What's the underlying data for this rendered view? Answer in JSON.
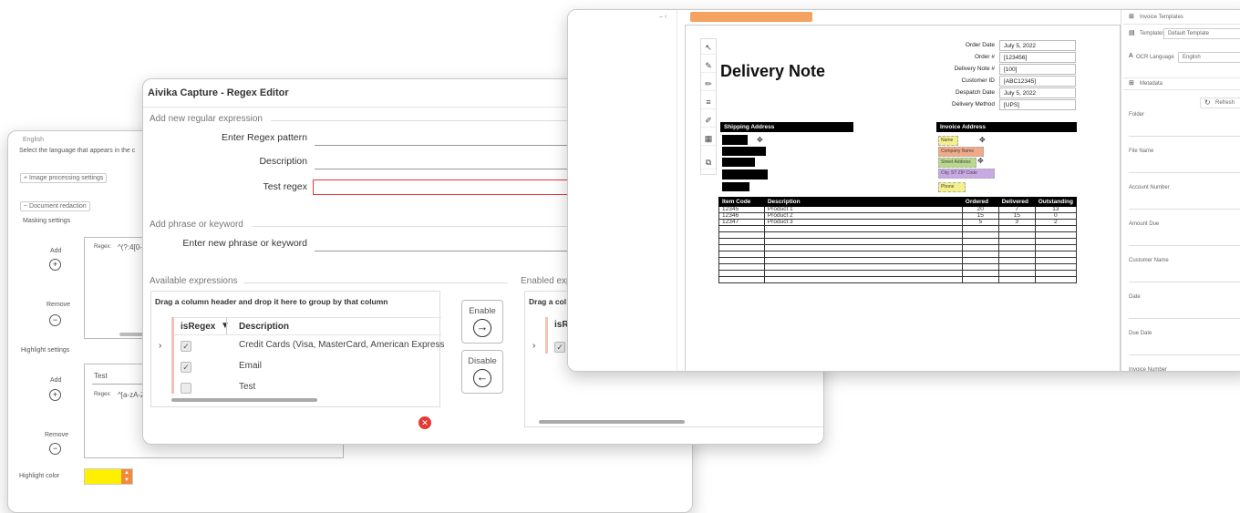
{
  "back": {
    "language_label": "English",
    "language_hint": "Select the language that appears in the c",
    "image_processing": "Image processing settings",
    "doc_redaction": "Document redaction",
    "masking_settings": "Masking settings",
    "add": "Add",
    "remove": "Remove",
    "regex_prefix": "Regex:",
    "mask_regex": "^(?:4[0-",
    "highlight_settings": "Highlight settings",
    "test_name": "Test",
    "hl_regex": "^[a-zA-Z",
    "highlight_color": "Highlight color",
    "highlight_color_hex": "#ffef00"
  },
  "regex_editor": {
    "title": "Aivika Capture - Regex Editor",
    "add_new_regex": "Add new regular expression",
    "pattern_label": "Enter Regex pattern",
    "description_label": "Description",
    "test_label": "Test regex",
    "add_phrase": "Add phrase or keyword",
    "phrase_label": "Enter new phrase or keyword",
    "available": "Available expressions",
    "enabled": "Enabled exp",
    "group_hint": "Drag a column header and drop it here to group by that column",
    "group_hint_short": "Drag a col",
    "col_isregex": "isRegex",
    "col_isregex_short": "isRe",
    "col_description": "Description",
    "rows": [
      {
        "checked": true,
        "description": "Credit Cards (Visa, MasterCard, American Express"
      },
      {
        "checked": true,
        "description": "Email"
      },
      {
        "checked": false,
        "description": "Test"
      }
    ],
    "enable_btn": "Enable",
    "disable_btn": "Disable"
  },
  "capture": {
    "doc_title": "Delivery Note",
    "meta": [
      {
        "label": "Order Date",
        "value": "July 5, 2022"
      },
      {
        "label": "Order #",
        "value": "[123456]"
      },
      {
        "label": "Delivery Note #",
        "value": "[100]"
      },
      {
        "label": "Customer ID",
        "value": "[ABC12345]"
      },
      {
        "label": "Despatch Date",
        "value": "July 5, 2022"
      },
      {
        "label": "Delivery Method",
        "value": "[UPS]"
      }
    ],
    "shipping_address": "Shipping Address",
    "invoice_address": "Invoice Address",
    "inv_tags": [
      "Name",
      "Company Name",
      "Street Address",
      "City, ST ZIP Code",
      "Phone"
    ],
    "table_headers": [
      "Item Code",
      "Description",
      "Ordered",
      "Delivered",
      "Outstanding"
    ],
    "table_rows": [
      [
        "12345",
        "Product 1",
        "20",
        "7",
        "13"
      ],
      [
        "12346",
        "Product 2",
        "15",
        "15",
        "0"
      ],
      [
        "12347",
        "Product 3",
        "5",
        "3",
        "2"
      ]
    ],
    "right_panel": {
      "invoice_templates": "Invoice Templates",
      "templates_label": "Templates",
      "templates_value": "Default Template",
      "ocr_label": "OCR Language",
      "ocr_value": "English",
      "metadata": "Metadata",
      "refresh": "Refresh",
      "fields": [
        "Folder",
        "File Name",
        "Account Number",
        "Amount Due",
        "Customer Name",
        "Date",
        "Due Date",
        "Invoice Number"
      ]
    }
  }
}
